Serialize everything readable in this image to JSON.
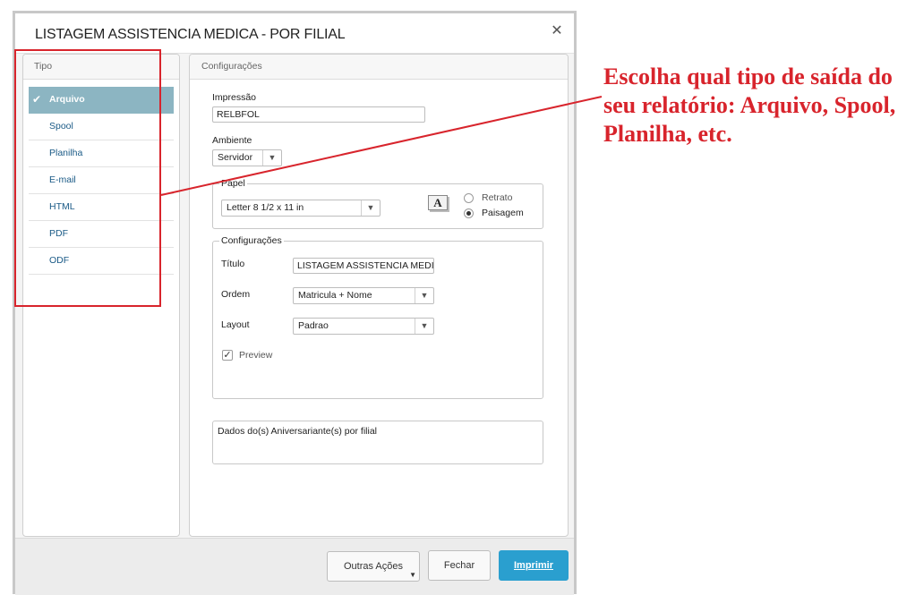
{
  "dialog": {
    "title": "LISTAGEM ASSISTENCIA MEDICA - POR FILIAL",
    "close_icon": "close-icon"
  },
  "tipo": {
    "header": "Tipo",
    "items": [
      {
        "label": "Arquivo",
        "selected": true
      },
      {
        "label": "Spool",
        "selected": false
      },
      {
        "label": "Planilha",
        "selected": false
      },
      {
        "label": "E-mail",
        "selected": false
      },
      {
        "label": "HTML",
        "selected": false
      },
      {
        "label": "PDF",
        "selected": false
      },
      {
        "label": "ODF",
        "selected": false
      }
    ]
  },
  "config": {
    "header": "Configurações",
    "impressao_label": "Impressão",
    "impressao_value": "RELBFOL",
    "ambiente_label": "Ambiente",
    "ambiente_value": "Servidor",
    "papel_label": "Papel",
    "papel_value": "Letter 8 1/2 x 11 in",
    "paper_icon_letter": "A",
    "retrato_label": "Retrato",
    "paisagem_label": "Paisagem",
    "orientation_selected": "Paisagem",
    "group_label": "Configurações",
    "titulo_label": "Título",
    "titulo_value": "LISTAGEM ASSISTENCIA MEDIC",
    "ordem_label": "Ordem",
    "ordem_value": "Matricula + Nome",
    "layout_label": "Layout",
    "layout_value": "Padrao",
    "preview_label": "Preview",
    "preview_checked": true,
    "description": "Dados do(s) Aniversariante(s) por filial"
  },
  "footer": {
    "outras_acoes": "Outras Ações",
    "fechar": "Fechar",
    "imprimir": "Imprimir"
  },
  "annotation": {
    "text": "Escolha qual tipo de saída do seu relatório: Arquivo, Spool, Planilha, etc.",
    "color": "#d8242c"
  },
  "colors": {
    "selected_item": "#8cb5c2",
    "primary_button": "#2a9fcf",
    "link_text": "#1a5a86"
  }
}
